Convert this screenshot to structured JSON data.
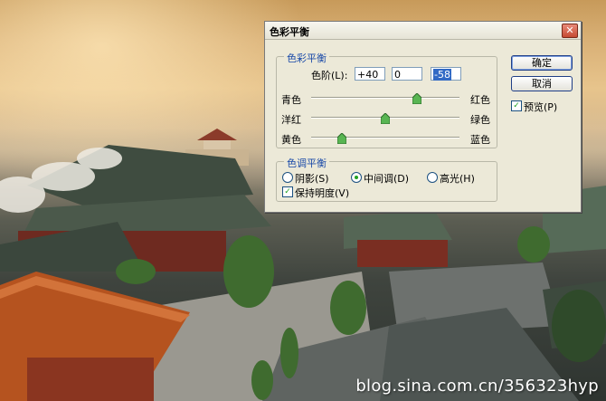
{
  "dialog": {
    "title": "色彩平衡",
    "close_glyph": "✕",
    "color_balance_group": {
      "legend": "色彩平衡",
      "levels_label": "色阶(L):",
      "levels": [
        "+40",
        "0",
        "-58"
      ],
      "sliders": [
        {
          "left": "青色",
          "right": "红色",
          "value": 40
        },
        {
          "left": "洋红",
          "right": "绿色",
          "value": 0
        },
        {
          "left": "黄色",
          "right": "蓝色",
          "value": -58
        }
      ]
    },
    "tone_balance_group": {
      "legend": "色调平衡",
      "shadows": "阴影(S)",
      "midtones": "中间调(D)",
      "highlights": "高光(H)",
      "selected": "midtones",
      "preserve_luminosity": "保持明度(V)",
      "preserve_checked": true
    },
    "ok_label": "确定",
    "cancel_label": "取消",
    "preview_label": "预览(P)",
    "preview_checked": true
  },
  "watermark": "blog.sina.com.cn/356323hyp",
  "colors": {
    "accent": "#1a4aa8",
    "dialog_bg": "#ece9d8",
    "check_green": "#21a121"
  }
}
